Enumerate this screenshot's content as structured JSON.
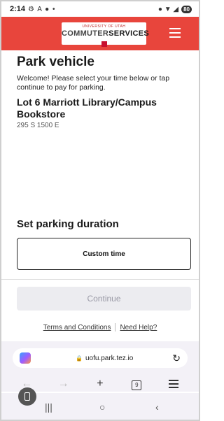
{
  "status_bar": {
    "time": "2:14",
    "left_icons": "⚙ A ● •",
    "right_icons": "● ▼ ◢",
    "battery": "80"
  },
  "header": {
    "logo_top": "UNIVERSITY OF UTAH",
    "logo_commuter": "COMMUTER",
    "logo_services": "SERVICES",
    "menu_icon": "hamburger-menu-icon"
  },
  "main": {
    "title": "Park vehicle",
    "welcome": "Welcome! Please select your time below or tap continue to pay for parking.",
    "lot_name": "Lot 6 Marriott Library/Campus Bookstore",
    "lot_address": "295 S 1500 E",
    "duration_title": "Set parking duration",
    "custom_time_label": "Custom time",
    "continue_label": "Continue",
    "terms_link": "Terms and Conditions",
    "help_link": "Need Help?"
  },
  "browser": {
    "url": "uofu.park.tez.io",
    "lock_icon": "🔒",
    "reload_icon": "↻",
    "back_icon": "←",
    "forward_icon": "→",
    "new_tab_icon": "+",
    "tab_count": "9"
  },
  "system_nav": {
    "recents_icon": "|||",
    "home_icon": "○",
    "back_icon": "‹"
  },
  "colors": {
    "brand_red": "#e8453c",
    "continue_disabled_bg": "#ececf0"
  }
}
